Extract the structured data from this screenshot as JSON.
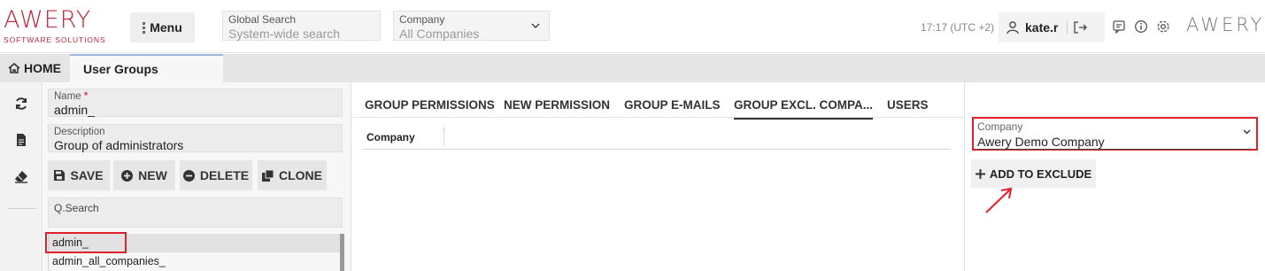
{
  "header": {
    "logo_text": "AWERY",
    "logo_subtitle": "SOFTWARE SOLUTIONS",
    "menu_label": "Menu",
    "global_search": {
      "label": "Global Search",
      "placeholder": "System-wide search"
    },
    "company": {
      "label": "Company",
      "value": "All Companies"
    },
    "timezone": "17:17 (UTC +2)",
    "username": "kate.r",
    "logo_right": "AWERY",
    "icons": [
      "user-icon",
      "logout-icon",
      "chat-icon",
      "info-icon",
      "gear-icon"
    ]
  },
  "tabs": {
    "home": "HOME",
    "current": "User Groups"
  },
  "form": {
    "name_label": "Name",
    "name_required": "*",
    "name_value": "admin_",
    "description_label": "Description",
    "description_value": "Group of administrators",
    "buttons": {
      "save": "SAVE",
      "new": "NEW",
      "delete": "DELETE",
      "clone": "CLONE"
    },
    "search_label": "Q.Search",
    "list": [
      "admin_",
      "admin_all_companies_"
    ]
  },
  "panel_tabs": [
    "GROUP PERMISSIONS",
    "NEW PERMISSION",
    "GROUP E-MAILS",
    "GROUP EXCL. COMPA...",
    "USERS"
  ],
  "active_tab": "GROUP EXCL. COMPA...",
  "grid": {
    "columns": [
      "Company"
    ]
  },
  "right": {
    "company_label": "Company",
    "company_value": "Awery Demo Company",
    "add_button": "ADD TO EXCLUDE"
  },
  "colors": {
    "brand": "#c0263b",
    "highlight": "#e0202a"
  }
}
